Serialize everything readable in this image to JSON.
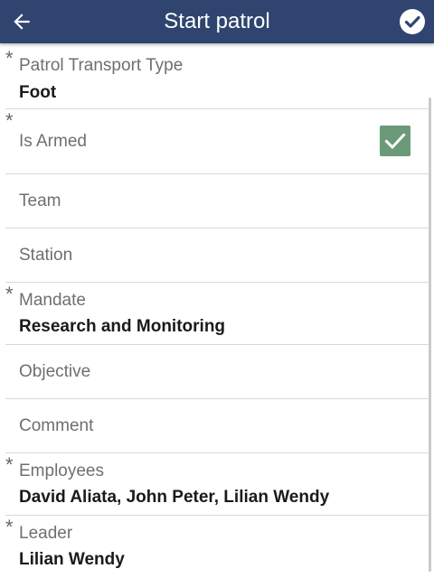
{
  "header": {
    "title": "Start patrol",
    "back_icon": "arrow-left-icon",
    "confirm_icon": "check-circle-icon",
    "color": "#2f4570"
  },
  "form": {
    "required_marker": "*",
    "fields": {
      "transport": {
        "label": "Patrol Transport Type",
        "value": "Foot",
        "required": true
      },
      "armed": {
        "label": "Is Armed",
        "checked": true,
        "required": true,
        "checkbox_color": "#6a9a78"
      },
      "team": {
        "label": "Team"
      },
      "station": {
        "label": "Station"
      },
      "mandate": {
        "label": "Mandate",
        "value": "Research and Monitoring",
        "required": true
      },
      "objective": {
        "label": "Objective"
      },
      "comment": {
        "label": "Comment"
      },
      "employees": {
        "label": "Employees",
        "value": "David Aliata, John Peter, Lilian Wendy",
        "required": true
      },
      "leader": {
        "label": "Leader",
        "value": "Lilian Wendy",
        "required": true
      }
    }
  }
}
